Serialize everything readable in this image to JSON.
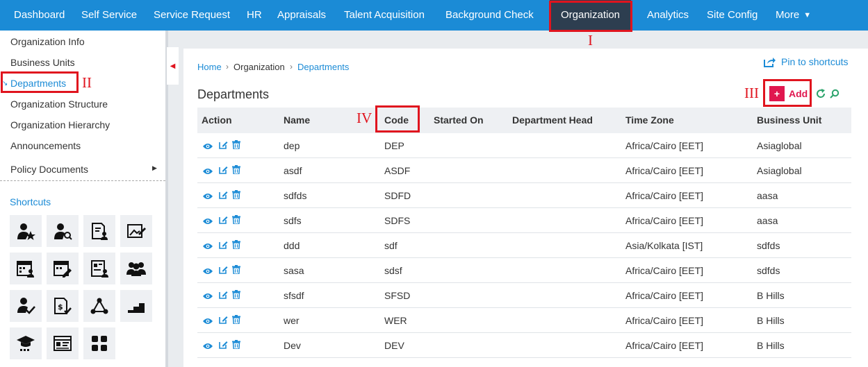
{
  "nav": {
    "items": [
      "Dashboard",
      "Self Service",
      "Service Request",
      "HR",
      "Appraisals",
      "Talent Acquisition",
      "Background Check",
      "Organization",
      "Analytics",
      "Site Config",
      "More"
    ],
    "active": "Organization"
  },
  "annotations": [
    "I",
    "II",
    "III",
    "IV"
  ],
  "sidebar": {
    "items": [
      "Organization Info",
      "Business Units",
      "Departments",
      "Organization Structure",
      "Organization Hierarchy",
      "Announcements",
      "Policy Documents"
    ],
    "active": "Departments",
    "shortcuts_title": "Shortcuts",
    "shortcuts": [
      "employee-star-icon",
      "employee-search-icon",
      "document-user-icon",
      "travel-request-icon",
      "calendar-user-icon",
      "calendar-edit-icon",
      "profile-card-icon",
      "team-icon",
      "employee-check-icon",
      "expense-check-icon",
      "network-nodes-icon",
      "steps-icon",
      "training-icon",
      "id-card-icon",
      "grid-apps-icon"
    ]
  },
  "breadcrumb": [
    "Home",
    "Organization",
    "Departments"
  ],
  "pin_label": "Pin to shortcuts",
  "page_title": "Departments",
  "add_label": "Add",
  "add_plus": "+",
  "table": {
    "headers": [
      "Action",
      "Name",
      "Code",
      "Started On",
      "Department Head",
      "Time Zone",
      "Business Unit"
    ],
    "rows": [
      [
        "dep",
        "DEP",
        "",
        "",
        "Africa/Cairo [EET]",
        "Asiaglobal"
      ],
      [
        "asdf",
        "ASDF",
        "",
        "",
        "Africa/Cairo [EET]",
        "Asiaglobal"
      ],
      [
        "sdfds",
        "SDFD",
        "",
        "",
        "Africa/Cairo [EET]",
        "aasa"
      ],
      [
        "sdfs",
        "SDFS",
        "",
        "",
        "Africa/Cairo [EET]",
        "aasa"
      ],
      [
        "ddd",
        "sdf",
        "",
        "",
        "Asia/Kolkata [IST]",
        "sdfds"
      ],
      [
        "sasa",
        "sdsf",
        "",
        "",
        "Africa/Cairo [EET]",
        "sdfds"
      ],
      [
        "sfsdf",
        "SFSD",
        "",
        "",
        "Africa/Cairo [EET]",
        "B Hills"
      ],
      [
        "wer",
        "WER",
        "",
        "",
        "Africa/Cairo [EET]",
        "B Hills"
      ],
      [
        "Dev",
        "DEV",
        "",
        "",
        "Africa/Cairo [EET]",
        "B Hills"
      ]
    ]
  },
  "colors": {
    "nav_bg": "#1b8bd6",
    "nav_active_bg": "#2d3e50",
    "accent": "#1b8bd6",
    "annotation": "#e0141e",
    "add": "#e0174f",
    "action_icon": "#1b8bd6"
  }
}
